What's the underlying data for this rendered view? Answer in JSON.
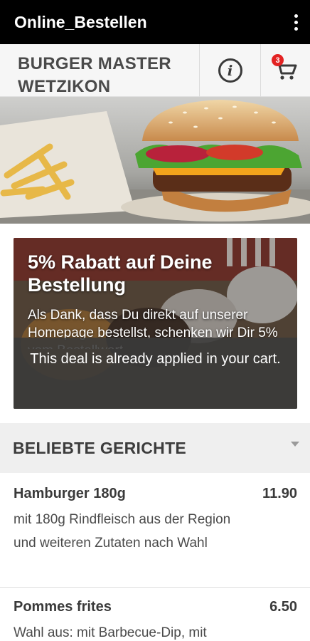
{
  "appbar": {
    "title": "Online_Bestellen",
    "overflow_icon": "more-vert-icon"
  },
  "header": {
    "restaurant_name": "BURGER MASTER WETZIKON",
    "info_icon": "info-icon",
    "cart_icon": "cart-icon",
    "cart_count": "3",
    "badge_color": "#e32222"
  },
  "promo": {
    "title": "5% Rabatt auf Deine Bestellung",
    "text": "Als Dank, dass Du direkt auf unserer Homepage bestellst, schenken wir Dir 5% vom Bestellwert.",
    "notice": "This deal is already applied in your cart."
  },
  "menu": {
    "section_title": "BELIEBTE GERICHTE",
    "dishes": [
      {
        "name": "Hamburger 180g",
        "price": "11.90",
        "description": "mit 180g Rindfleisch aus der Region und weiteren Zutaten nach Wahl"
      },
      {
        "name": "Pommes frites",
        "price": "6.50",
        "description": "Wahl aus: mit Barbecue-Dip, mit"
      }
    ]
  }
}
